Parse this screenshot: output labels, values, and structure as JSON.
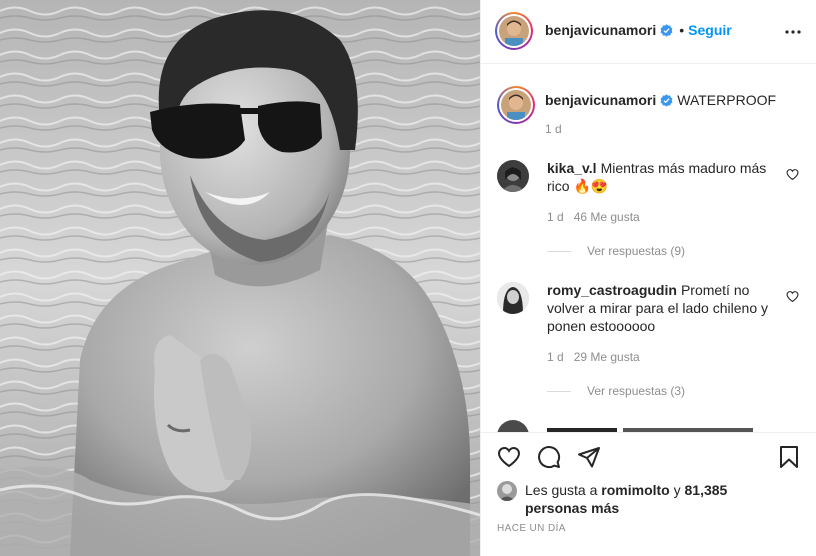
{
  "post": {
    "author": {
      "username": "benjavicunamori",
      "verified_icon": "verified-badge-icon",
      "follow_label": "Seguir",
      "separator": "•",
      "more_icon": "more-options-icon"
    },
    "caption": {
      "username": "benjavicunamori",
      "text": "WATERPROOF",
      "time": "1 d"
    },
    "comments": [
      {
        "username": "kika_v.l",
        "text": "Mientras más maduro más rico 🔥😍",
        "time": "1 d",
        "likes": "46 Me gusta",
        "replies": "Ver respuestas (9)"
      },
      {
        "username": "romy_castroagudin",
        "text": "Prometí no volver a mirar para el lado chileno y ponen estoooooo",
        "time": "1 d",
        "likes": "29 Me gusta",
        "replies": "Ver respuestas (3)"
      }
    ],
    "actions": {
      "like_icon": "heart-icon",
      "comment_icon": "comment-icon",
      "share_icon": "share-icon",
      "save_icon": "bookmark-icon"
    },
    "likes": {
      "prefix": "Les gusta a",
      "user": "romimolto",
      "connector": "y",
      "others": "81,385 personas más"
    },
    "date": "HACE UN DÍA"
  },
  "colors": {
    "link": "#0095f6",
    "verified": "#3897f0",
    "muted": "#8e8e8e",
    "text": "#262626"
  }
}
